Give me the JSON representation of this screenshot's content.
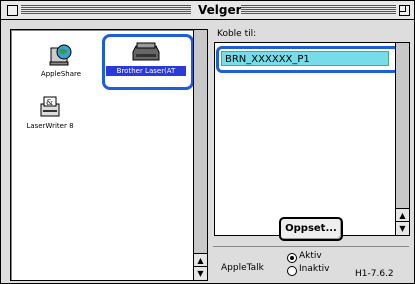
{
  "window": {
    "title": "Velger"
  },
  "left": {
    "items": [
      {
        "label": "AppleShare",
        "icon": "appleshare-globe-icon"
      },
      {
        "label": "Brother Laser(AT",
        "icon": "printer-icon",
        "selected": true
      },
      {
        "label": "LaserWriter 8",
        "icon": "laserwriter-icon"
      }
    ]
  },
  "right": {
    "connect_label": "Koble til:",
    "selected_printer": "BRN_XXXXXX_P1",
    "setup_button": "Oppset...",
    "appletalk_label": "AppleTalk",
    "appletalk_on": "Aktiv",
    "appletalk_off": "Inaktiv",
    "version": "H1-7.6.2"
  },
  "colors": {
    "accent_ring": "#1e5fd6",
    "selection_fill": "#75dce8"
  }
}
